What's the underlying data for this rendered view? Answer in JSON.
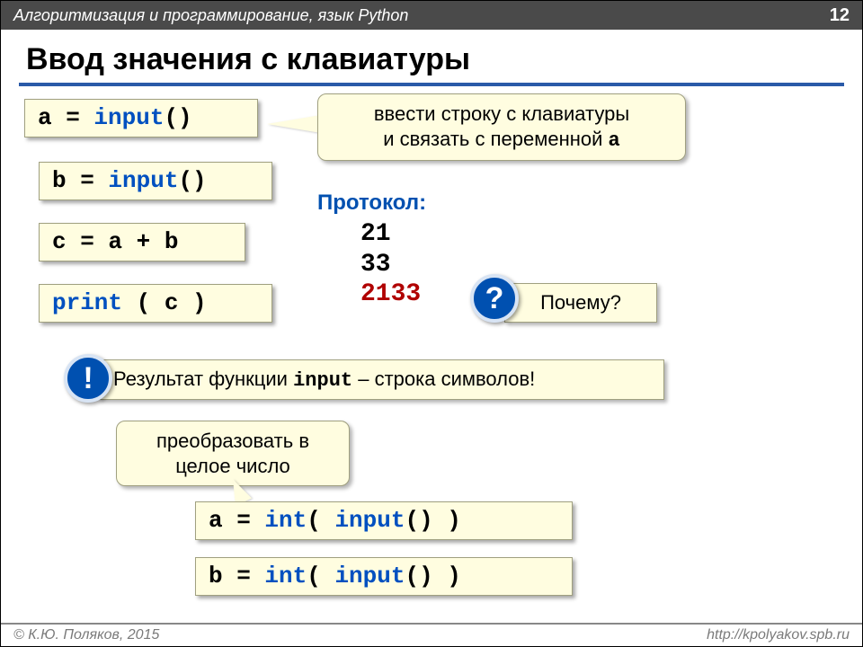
{
  "topbar": {
    "title": "Алгоритмизация и программирование, язык Python",
    "pagenum": "12"
  },
  "slide": {
    "title": "Ввод значения с клавиатуры"
  },
  "code": {
    "box1_a": "a",
    "box1_eq": " = ",
    "box1_fn": "input",
    "box1_paren": "()",
    "box2_b": "b",
    "box2_eq": " = ",
    "box2_fn": "input",
    "box2_paren": "()",
    "box3_c": "c",
    "box3_eq": " = ",
    "box3_expr": "a + b",
    "box4_fn": "print",
    "box4_arg": " ( c )",
    "box5_a": "a",
    "box5_eq": " = ",
    "box5_int": "int",
    "box5_open": "( ",
    "box5_input": "input",
    "box5_close": "() )",
    "box6_b": "b",
    "box6_eq": " = ",
    "box6_int": "int",
    "box6_open": "( ",
    "box6_input": "input",
    "box6_close": "() )"
  },
  "callouts": {
    "top_line1": "ввести строку с клавиатуры",
    "top_line2_pre": "и связать с переменной ",
    "top_line2_var": "a",
    "convert_line1": "преобразовать в",
    "convert_line2": "целое число"
  },
  "protocol": {
    "label": "Протокол:",
    "v1": "21",
    "v2": "33",
    "v3": "2133"
  },
  "question": {
    "mark": "?",
    "text": "Почему?"
  },
  "exclaim": {
    "mark": "!",
    "text_pre": "Результат функции ",
    "text_fn": "input",
    "text_post": " – строка символов!"
  },
  "footer": {
    "left": "© К.Ю. Поляков, 2015",
    "right": "http://kpolyakov.spb.ru"
  }
}
